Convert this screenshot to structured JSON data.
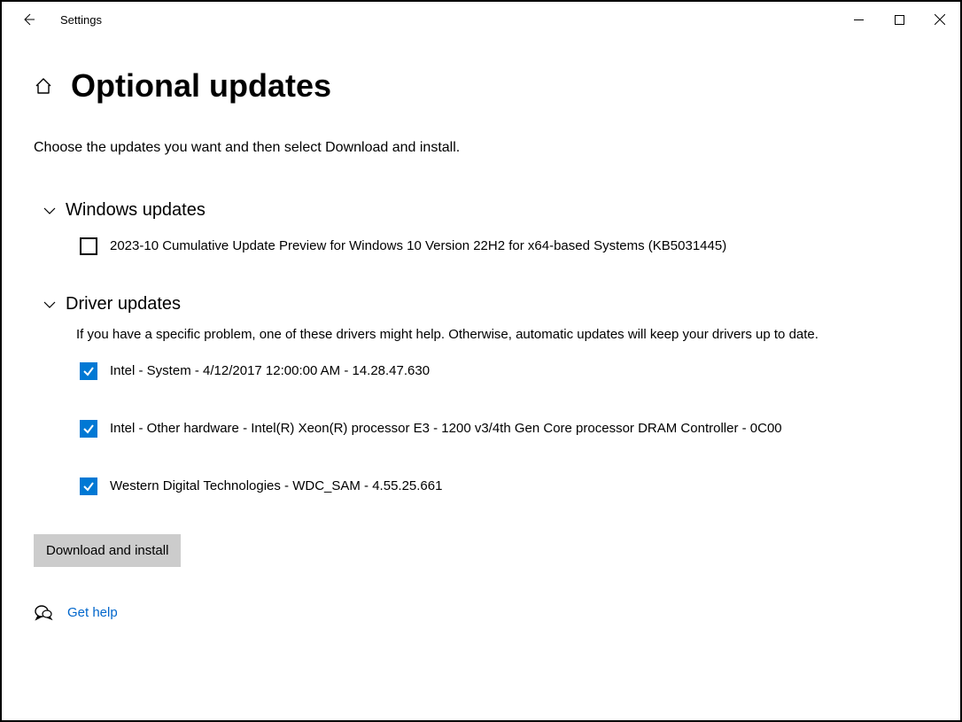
{
  "window": {
    "title": "Settings"
  },
  "page": {
    "title": "Optional updates",
    "instruction": "Choose the updates you want and then select Download and install."
  },
  "sections": {
    "windows": {
      "title": "Windows updates",
      "items": [
        {
          "label": "2023-10 Cumulative Update Preview for Windows 10 Version 22H2 for x64-based Systems (KB5031445)",
          "checked": false
        }
      ]
    },
    "drivers": {
      "title": "Driver updates",
      "description": "If you have a specific problem, one of these drivers might help. Otherwise, automatic updates will keep your drivers up to date.",
      "items": [
        {
          "label": "Intel - System - 4/12/2017 12:00:00 AM - 14.28.47.630",
          "checked": true
        },
        {
          "label": "Intel - Other hardware - Intel(R) Xeon(R) processor E3 - 1200 v3/4th Gen Core processor DRAM Controller - 0C00",
          "checked": true
        },
        {
          "label": "Western Digital Technologies - WDC_SAM - 4.55.25.661",
          "checked": true
        }
      ]
    }
  },
  "actions": {
    "download_label": "Download and install",
    "help_label": "Get help"
  }
}
